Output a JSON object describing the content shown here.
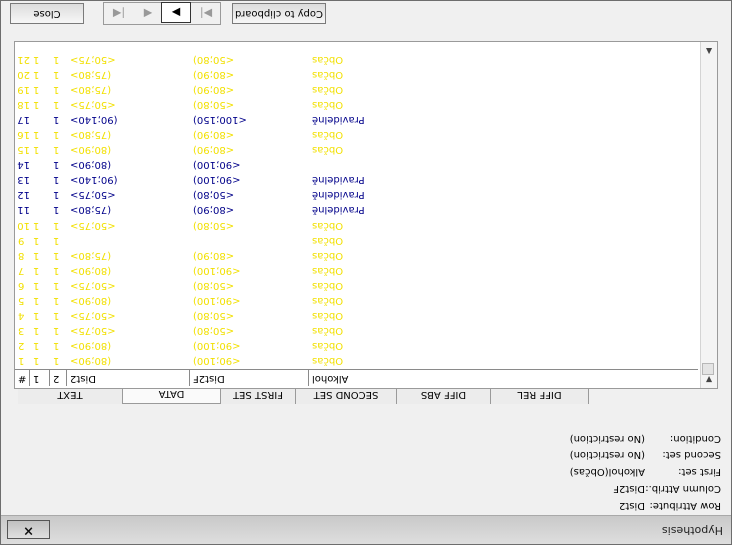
{
  "window": {
    "title": "Hypothesis",
    "close_label": "×"
  },
  "info": [
    {
      "label": "Row Attribute:",
      "value": "Dist2"
    },
    {
      "label": "Column Attrib.:",
      "value": "Dist2F"
    },
    {
      "label": "First set:",
      "value": "Alkohol(Občas)"
    },
    {
      "label": "Second set:",
      "value": "(No restriction)"
    },
    {
      "label": "Condition:",
      "value": "(No restriction)"
    }
  ],
  "tabs": [
    {
      "label": "TEXT",
      "active": false
    },
    {
      "label": "DATA",
      "active": true
    },
    {
      "label": "FIRST SET",
      "active": false
    },
    {
      "label": "SECOND SET",
      "active": false
    },
    {
      "label": "DIFF ABS",
      "active": false
    },
    {
      "label": "DIFF REL",
      "active": false
    }
  ],
  "grid": {
    "headers": [
      "#",
      "1",
      "2",
      "Dist2",
      "Dist2F",
      "Alkohol"
    ],
    "rows": [
      {
        "id": "1",
        "c1": "1",
        "c2": "1",
        "dist2": "(80;90>",
        "dist2f": "<90;100)",
        "alk": "Občas",
        "color": "yellow"
      },
      {
        "id": "2",
        "c1": "1",
        "c2": "1",
        "dist2": "(80;90>",
        "dist2f": "<90;100)",
        "alk": "Občas",
        "color": "yellow"
      },
      {
        "id": "3",
        "c1": "1",
        "c2": "1",
        "dist2": "<50;75>",
        "dist2f": "<50;80)",
        "alk": "Občas",
        "color": "yellow"
      },
      {
        "id": "4",
        "c1": "1",
        "c2": "1",
        "dist2": "<50;75>",
        "dist2f": "<50;80)",
        "alk": "Občas",
        "color": "yellow"
      },
      {
        "id": "5",
        "c1": "1",
        "c2": "1",
        "dist2": "(80;90>",
        "dist2f": "<90;100)",
        "alk": "Občas",
        "color": "yellow"
      },
      {
        "id": "6",
        "c1": "1",
        "c2": "1",
        "dist2": "<50;75>",
        "dist2f": "<50;80)",
        "alk": "Občas",
        "color": "yellow"
      },
      {
        "id": "7",
        "c1": "1",
        "c2": "1",
        "dist2": "(80;90>",
        "dist2f": "<90;100)",
        "alk": "Občas",
        "color": "yellow"
      },
      {
        "id": "8",
        "c1": "1",
        "c2": "1",
        "dist2": "(75;80>",
        "dist2f": "<80;90)",
        "alk": "Občas",
        "color": "yellow"
      },
      {
        "id": "9",
        "c1": "1",
        "c2": "1",
        "dist2": "",
        "dist2f": "",
        "alk": "Občas",
        "color": "yellow"
      },
      {
        "id": "10",
        "c1": "1",
        "c2": "1",
        "dist2": "<50;75>",
        "dist2f": "<50;80)",
        "alk": "Občas",
        "color": "yellow"
      },
      {
        "id": "11",
        "c1": "",
        "c2": "1",
        "dist2": "(75;80>",
        "dist2f": "<80;90)",
        "alk": "Pravidelně",
        "color": "blue"
      },
      {
        "id": "12",
        "c1": "",
        "c2": "1",
        "dist2": "<50;75>",
        "dist2f": "<50;80)",
        "alk": "Pravidelně",
        "color": "blue"
      },
      {
        "id": "13",
        "c1": "",
        "c2": "1",
        "dist2": "(90;140>",
        "dist2f": "<90;100)",
        "alk": "Pravidelně",
        "color": "blue"
      },
      {
        "id": "14",
        "c1": "",
        "c2": "1",
        "dist2": "(80;90>",
        "dist2f": "<90;100)",
        "alk": "",
        "color": "blue"
      },
      {
        "id": "15",
        "c1": "1",
        "c2": "1",
        "dist2": "(80;90>",
        "dist2f": "<80;90)",
        "alk": "Občas",
        "color": "yellow"
      },
      {
        "id": "16",
        "c1": "1",
        "c2": "1",
        "dist2": "(75;80>",
        "dist2f": "<80;90)",
        "alk": "Občas",
        "color": "yellow"
      },
      {
        "id": "17",
        "c1": "",
        "c2": "1",
        "dist2": "(90;140>",
        "dist2f": "<100;150)",
        "alk": "Pravidelně",
        "color": "blue"
      },
      {
        "id": "18",
        "c1": "1",
        "c2": "1",
        "dist2": "<50;75>",
        "dist2f": "<50;80)",
        "alk": "Občas",
        "color": "yellow"
      },
      {
        "id": "19",
        "c1": "1",
        "c2": "1",
        "dist2": "(75;80>",
        "dist2f": "<80;90)",
        "alk": "Občas",
        "color": "yellow"
      },
      {
        "id": "20",
        "c1": "1",
        "c2": "1",
        "dist2": "(75;80>",
        "dist2f": "<80;90)",
        "alk": "Občas",
        "color": "yellow"
      },
      {
        "id": "21",
        "c1": "1",
        "c2": "1",
        "dist2": "<50;75>",
        "dist2f": "<50;80)",
        "alk": "Občas",
        "color": "yellow"
      }
    ]
  },
  "toolbar": {
    "close_label": "Close",
    "copy_label": "Copy to clipboard",
    "first_icon": "skip-first-icon",
    "prev_icon": "prev-icon",
    "next_icon": "next-icon",
    "last_icon": "skip-last-icon",
    "active_nav": "next"
  },
  "colors": {
    "yellow_row": "#f2e000",
    "blue_row": "#00008a"
  }
}
